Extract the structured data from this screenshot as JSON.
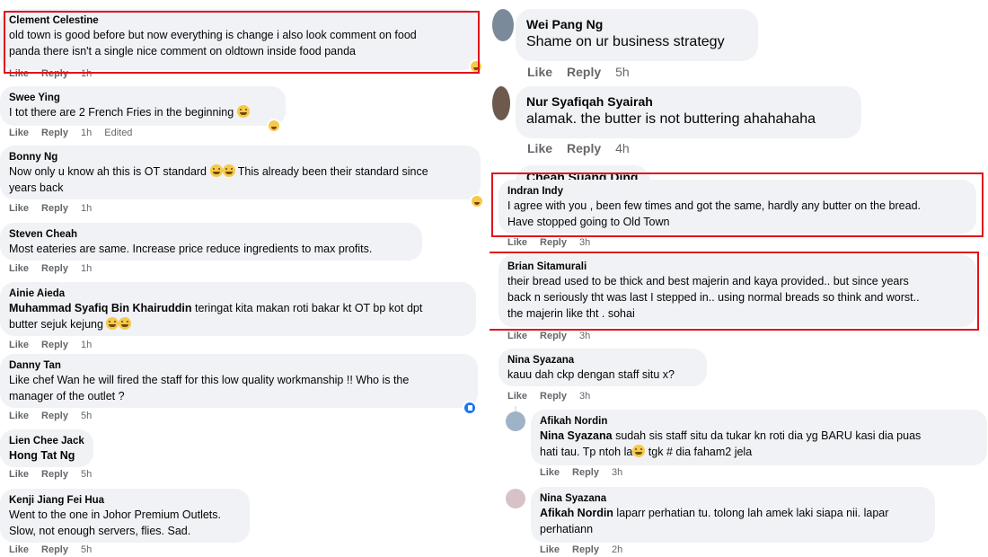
{
  "actions": {
    "like": "Like",
    "reply": "Reply",
    "edited": "Edited"
  },
  "left": [
    {
      "name": "Clement Celestine",
      "lines": [
        "old town is good before but now everything is change i also look comment on food",
        "panda there isn't a single nice comment on oldtown inside food panda"
      ],
      "time": "1h"
    },
    {
      "name": "Swee Ying",
      "lines": [
        "I tot there are 2 French Fries in the beginning"
      ],
      "time": "1h"
    },
    {
      "name": "Bonny Ng",
      "lines": [
        "Now only u know ah this is OT standard",
        "This already been their standard since",
        "years back"
      ],
      "time": "1h"
    },
    {
      "name": "Steven Cheah",
      "lines": [
        "Most eateries are same. Increase price reduce ingredients to max profits."
      ],
      "time": "1h"
    },
    {
      "name": "Ainie Aieda",
      "mention": "Muhammad Syafiq Bin Khairuddin",
      "lines": [
        " teringat kita makan roti bakar kt OT bp kot dpt",
        "butter sejuk kejung"
      ],
      "time": "1h"
    },
    {
      "name": "Danny Tan",
      "lines": [
        "Like chef Wan he will fired the staff for this low quality workmanship !! Who is the",
        "manager of the outlet ?"
      ],
      "time": "5h"
    },
    {
      "name": "Lien Chee Jack",
      "mention": "Hong Tat Ng",
      "lines": [],
      "time": "5h"
    },
    {
      "name": "Kenji Jiang Fei Hua",
      "lines": [
        "Went to the one in Johor Premium Outlets.",
        "Slow, not enough servers, flies. Sad."
      ],
      "time": "5h"
    }
  ],
  "right": [
    {
      "name": "Wei Pang Ng",
      "lines": [
        "Shame on ur business strategy"
      ],
      "time": "5h"
    },
    {
      "name": "Nur Syafiqah Syairah",
      "lines": [
        "alamak. the butter is not buttering ahahahaha"
      ],
      "time": "4h"
    },
    {
      "name": "Cheah Suang Ding"
    },
    {
      "name": "Indran Indy",
      "lines": [
        "I agree with you , been few times and got the same, hardly any butter on the bread.",
        "Have stopped going to Old Town"
      ],
      "time": "3h"
    },
    {
      "name": "Brian Sitamurali",
      "lines": [
        "their bread used to be thick and best majerin and kaya provided.. but since years",
        "back n seriously tht was last I stepped in.. using normal breads so think and worst..",
        "the majerin like tht . sohai"
      ],
      "time": "3h"
    },
    {
      "name": "Nina Syazana",
      "lines": [
        "kauu dah ckp dengan staff situ x?"
      ],
      "time": "3h"
    },
    {
      "name": "Afikah Nordin",
      "mention": "Nina Syazana",
      "lines": [
        " sudah sis staff situ da tukar kn roti dia yg BARU kasi dia puas",
        "hati tau. Tp ntoh la",
        " tgk # dia faham2 jela"
      ],
      "time": "3h"
    },
    {
      "name": "Nina Syazana",
      "mention": "Afikah Nordin",
      "lines": [
        " laparr perhatian tu. tolong lah amek laki siapa nii. lapar",
        "perhatiann"
      ],
      "time": "2h"
    }
  ],
  "colors": {
    "highlight": "#e0121a",
    "bubble": "#f0f2f5",
    "meta": "#65676b"
  }
}
